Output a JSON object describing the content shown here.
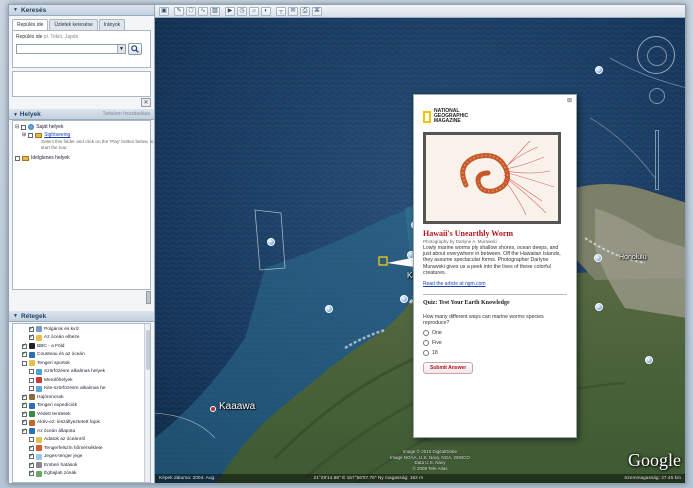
{
  "search": {
    "title": "Keresés",
    "tabs": [
      "Repülés ide",
      "Üzletek keresése",
      "Irányok"
    ],
    "hint_label": "Repülés ide",
    "hint_example": "pl. Tokió, Japán",
    "icons": [
      "search-icon",
      "dropdown-icon"
    ]
  },
  "places": {
    "title": "Helyek",
    "right_label": "Tartalom hozzáadása",
    "items": [
      {
        "label": "Saját helyek",
        "checked": false
      },
      {
        "label": "Sightseeing",
        "checked": false,
        "link": true
      },
      {
        "label": "Ideiglenes helyek",
        "checked": false
      }
    ],
    "description": "Select this folder and click on the 'Play' button below, to start the tour."
  },
  "layers": {
    "title": "Rétegek",
    "items": [
      {
        "label": "Polgárok és kvíz",
        "indent": 2,
        "checked": true,
        "color": "#7a9cc8"
      },
      {
        "label": "Az óceán elbeze",
        "indent": 2,
        "checked": true,
        "color": "#e6c04a"
      },
      {
        "label": "BBC - a Föld",
        "indent": 1,
        "checked": true,
        "color": "#222222"
      },
      {
        "label": "Cousteau és az óceán",
        "indent": 1,
        "checked": true,
        "color": "#2e6cb3"
      },
      {
        "label": "Tengeri sportok",
        "indent": 1,
        "checked": false,
        "color": "#e6c04a"
      },
      {
        "label": "Szörfözésre alkalmas helyek",
        "indent": 2,
        "checked": false,
        "color": "#4aa3d8"
      },
      {
        "label": "Merülőhelyek",
        "indent": 2,
        "checked": false,
        "color": "#c73a3a"
      },
      {
        "label": "Kite-szörfözésre alkalmas he",
        "indent": 2,
        "checked": false,
        "color": "#58a8d8"
      },
      {
        "label": "Hajóroncsok",
        "indent": 1,
        "checked": true,
        "color": "#8a6a3a"
      },
      {
        "label": "Tengeri expedíciók",
        "indent": 1,
        "checked": true,
        "color": "#2e6cb3"
      },
      {
        "label": "Védett területek",
        "indent": 1,
        "checked": true,
        "color": "#3a8a4a"
      },
      {
        "label": "Aktív-ez: leszállyeztetett fajok",
        "indent": 1,
        "checked": true,
        "color": "#c06a2a"
      },
      {
        "label": "Az óceán állapota",
        "indent": 1,
        "checked": true,
        "color": "#2e6cb3"
      },
      {
        "label": "Adatok az óceánról",
        "indent": 2,
        "checked": false,
        "color": "#e6c04a"
      },
      {
        "label": "Tengerfelszín hőmérséklete",
        "indent": 2,
        "checked": true,
        "color": "#d85a2a"
      },
      {
        "label": "Jeges-tenger jege",
        "indent": 2,
        "checked": true,
        "color": "#9ac8e8"
      },
      {
        "label": "Emberi hatások",
        "indent": 2,
        "checked": true,
        "color": "#888888"
      },
      {
        "label": "Éghajlati zónák",
        "indent": 2,
        "checked": true,
        "color": "#6aa86a"
      }
    ]
  },
  "toolbar": {
    "icons": [
      "sidebar-toggle-icon",
      "placemark-icon",
      "polygon-icon",
      "path-icon",
      "image-overlay-icon",
      "tour-icon",
      "historical-imagery-icon",
      "sun-icon",
      "planets-icon",
      "ruler-icon",
      "email-icon",
      "print-icon",
      "maps-icon"
    ]
  },
  "map": {
    "labels": [
      {
        "text": "Kaaawa"
      },
      {
        "text": "Ka"
      },
      {
        "text": "Honolulu"
      }
    ],
    "status": {
      "date": "Képek dátuma: 2004. Aug.",
      "coords": "21°29'14.86\" É   157°56'07.76\" Ny   magasság: 162 m",
      "eye": "Szemmagasság: 27.45 km"
    },
    "copyright": [
      "Image © 2010 DigitalGlobe",
      "Image NOAA, U.S. Navy, NGA, GEBCO",
      "Data U.S. Navy",
      "© 2009 Tele Atlas"
    ],
    "logo": "Google"
  },
  "balloon": {
    "brand": "NATIONAL\nGEOGRAPHIC\nMAGAZINE",
    "title": "Hawaii's Unearthly Worm",
    "credit": "Photography by Darlyne A. Murawski",
    "body": "Lowly marine worms ply shallow shores, ocean deeps, and just about everywhere in between. Off the Hawaiian Islands, they assume spectacular forms. Photographer Darlyne Murawski gives us a peek into the lives of these colorful creatures.",
    "link": "Read the article at ngm.com",
    "quiz_title": "Quiz: Test Your Earth Knowledge",
    "question": "How many different ways can marine worms species reproduce?",
    "options": [
      "One",
      "Five",
      "18"
    ],
    "submit": "Submit Answer"
  },
  "colors": {
    "accent_red": "#b3121c",
    "link": "#1a3fb0",
    "ng_yellow": "#f2c200"
  }
}
